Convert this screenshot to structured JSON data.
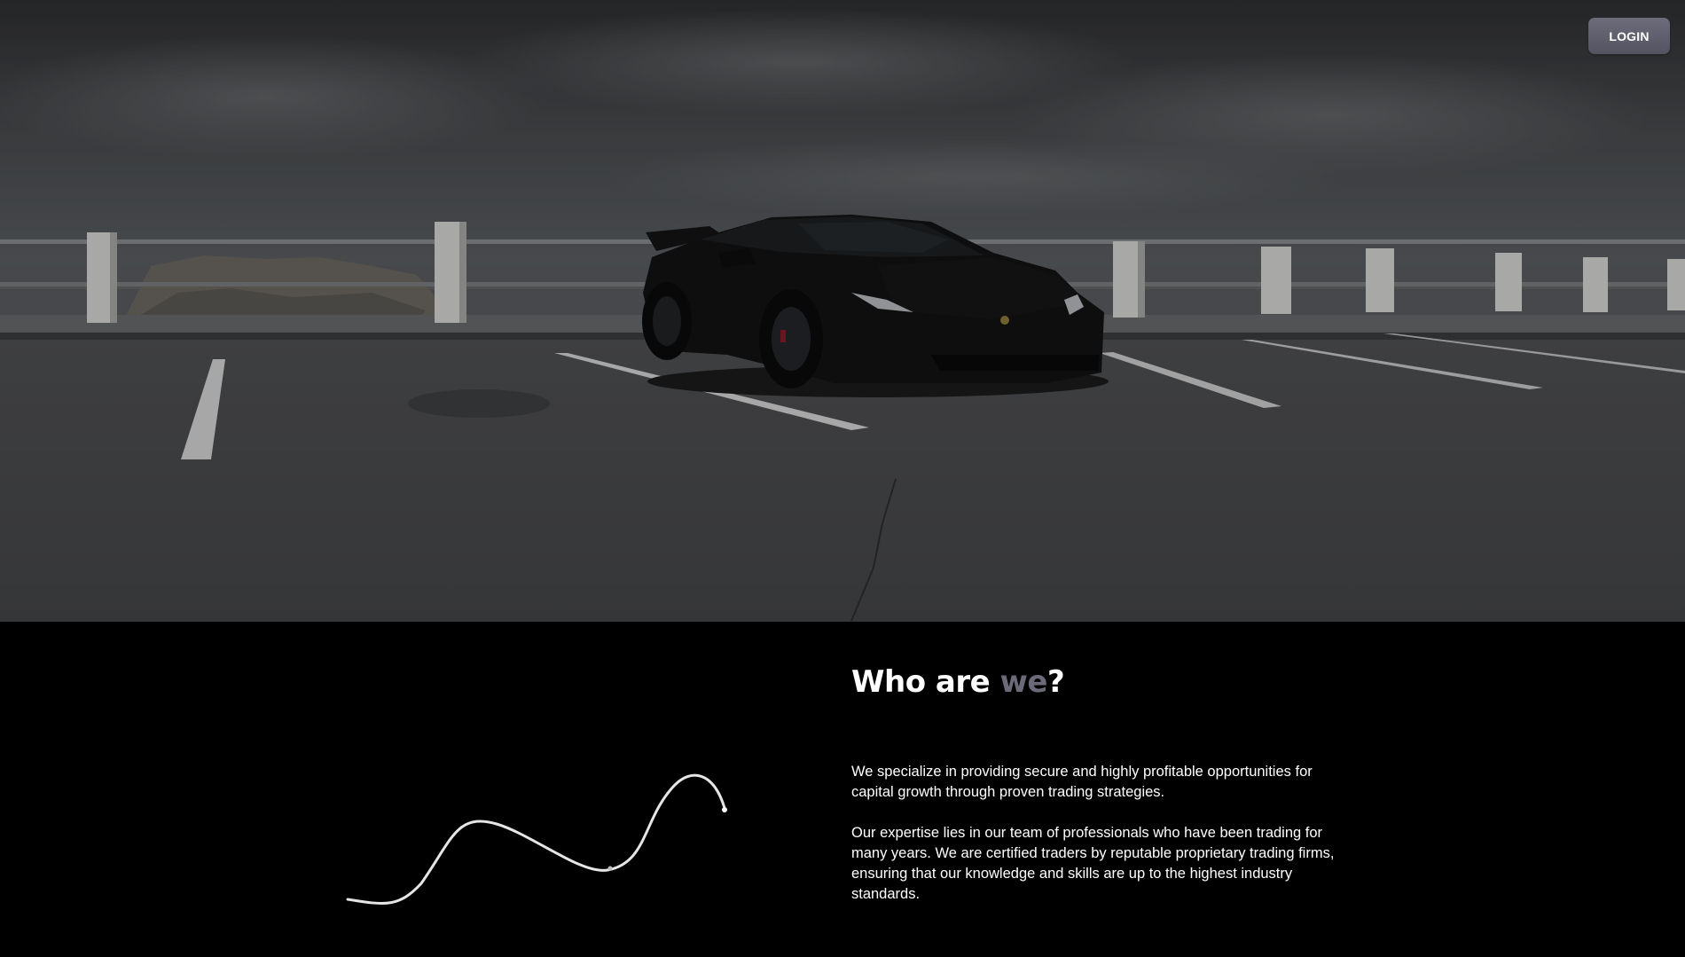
{
  "header": {
    "login_label": "LOGIN"
  },
  "about": {
    "heading_part1": "Who are ",
    "heading_accent": "we",
    "heading_part2": "?",
    "paragraphs": [
      "We specialize in providing secure and highly profitable opportunities for capital growth through proven trading strategies.",
      "Our expertise lies in our team of professionals who have been trading for many years. We are certified traders by reputable proprietary trading firms, ensuring that our knowledge and skills are up to the highest industry standards."
    ]
  },
  "colors": {
    "accent": "#6b6a78",
    "login_button": "#5f5e6c",
    "background": "#000000",
    "text": "#ffffff"
  },
  "icons": {
    "decor": "wave-curve-icon"
  }
}
